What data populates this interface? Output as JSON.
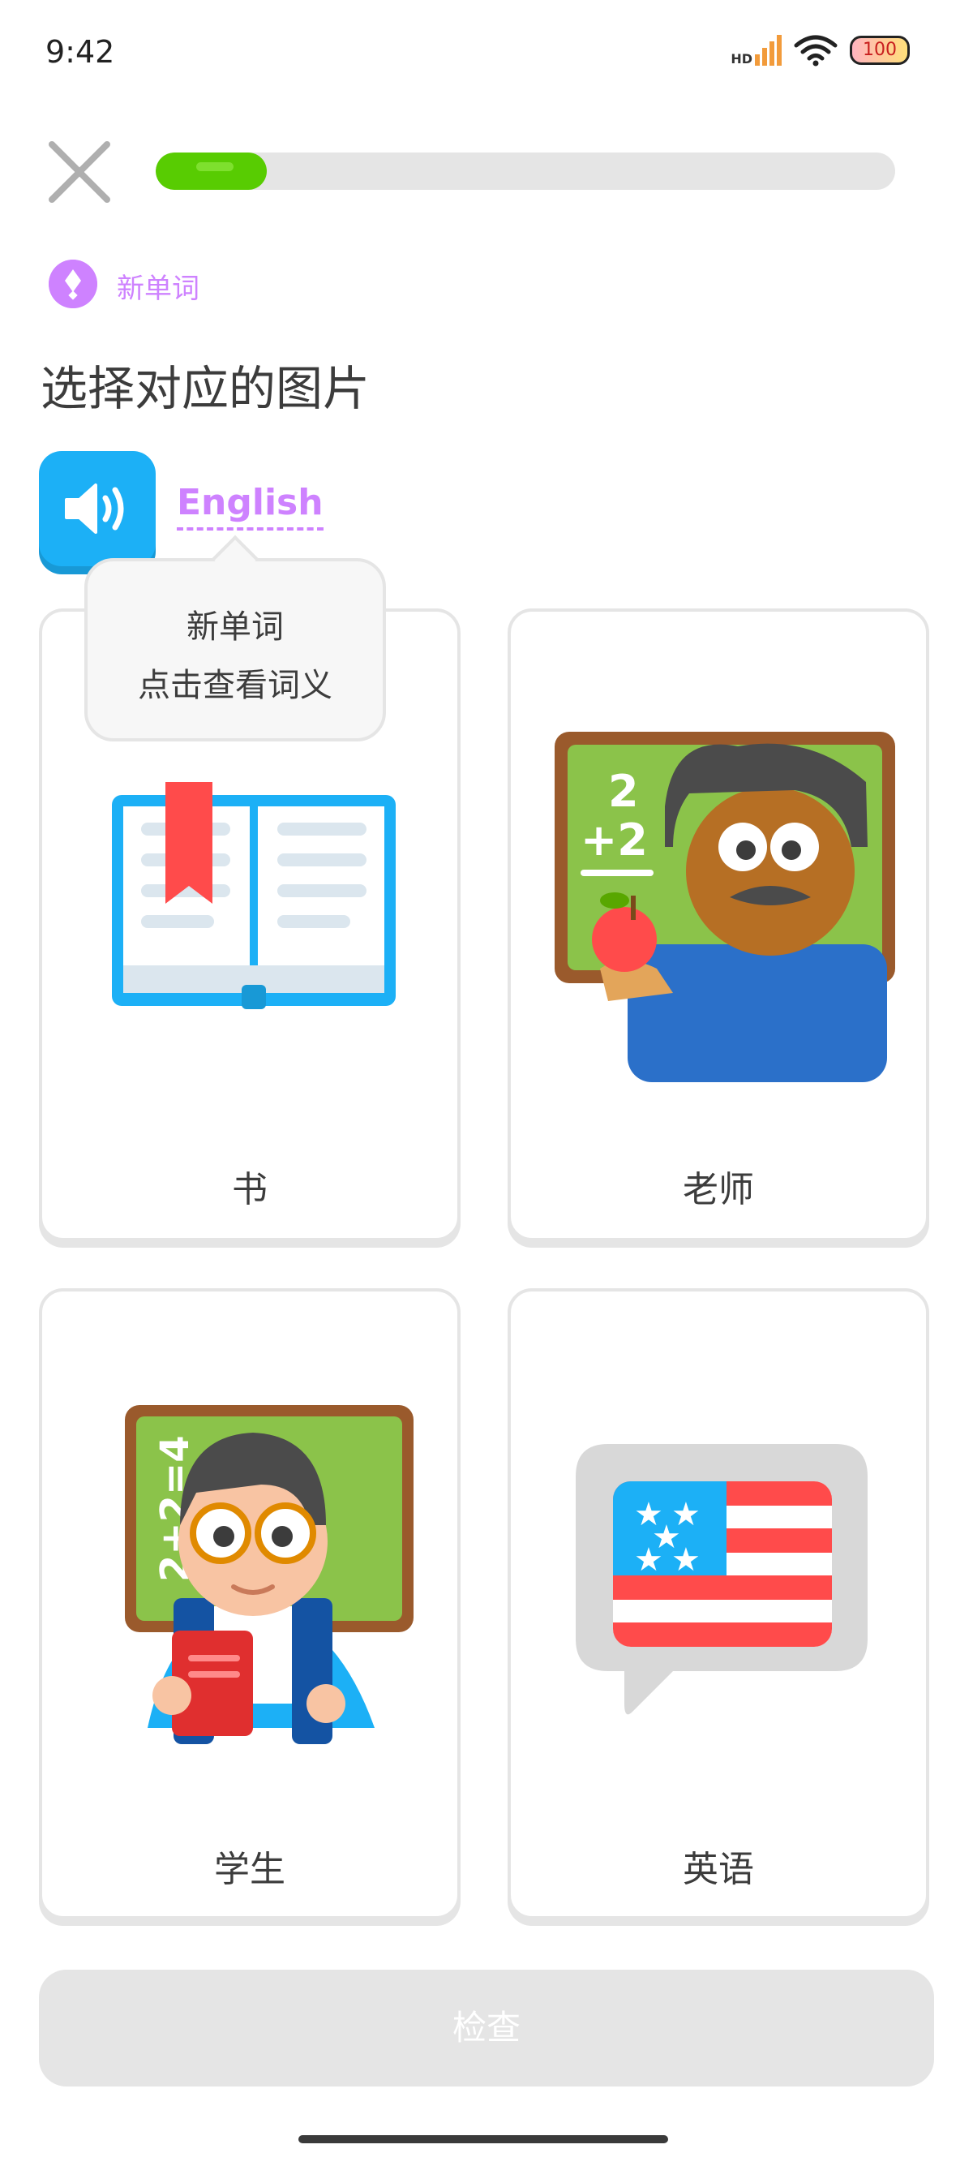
{
  "status_bar": {
    "time": "9:42",
    "hd": "HD",
    "battery": "100"
  },
  "progress": {
    "fraction": 0.15
  },
  "lesson_tag": {
    "label": "新单词",
    "icon": "sparkle-badge-icon"
  },
  "title": "选择对应的图片",
  "prompt": {
    "word": "English",
    "speaker_icon": "speaker-icon"
  },
  "tooltip": {
    "line1": "新单词",
    "line2": "点击查看词义"
  },
  "options": [
    {
      "label": "书",
      "icon": "book-icon"
    },
    {
      "label": "老师",
      "icon": "teacher-icon"
    },
    {
      "label": "学生",
      "icon": "student-icon"
    },
    {
      "label": "英语",
      "icon": "us-flag-speech-icon"
    }
  ],
  "check_button": {
    "label": "检查"
  },
  "colors": {
    "accent_purple": "#ce82ff",
    "accent_blue": "#1cb0f6",
    "progress_green": "#58cc02"
  }
}
